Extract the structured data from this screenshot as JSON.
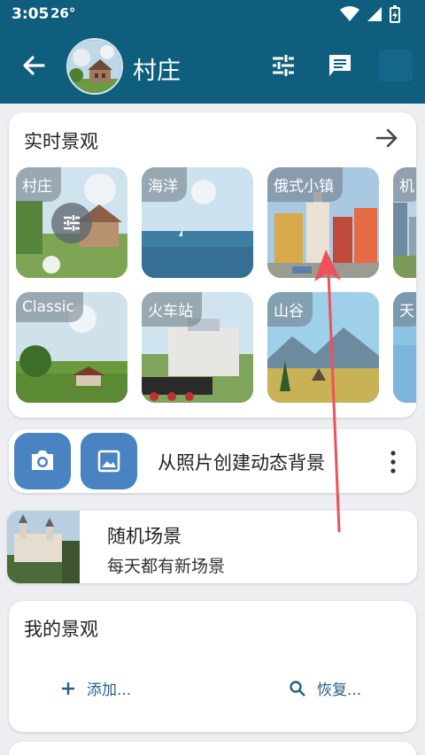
{
  "status": {
    "time": "3:05",
    "temperature": "26°"
  },
  "header": {
    "title": "村庄",
    "colors": {
      "bar": "#0f5e7d"
    }
  },
  "live": {
    "title": "实时景观",
    "tiles": [
      {
        "label": "村庄",
        "scene": "village"
      },
      {
        "label": "海洋",
        "scene": "ocean"
      },
      {
        "label": "俄式小镇",
        "scene": "russian-town"
      },
      {
        "label": "机",
        "scene": "city"
      },
      {
        "label": "Classic",
        "scene": "classic"
      },
      {
        "label": "火车站",
        "scene": "train-station"
      },
      {
        "label": "山谷",
        "scene": "valley"
      },
      {
        "label": "天",
        "scene": "sky"
      }
    ]
  },
  "photo": {
    "label": "从照片创建动态背景"
  },
  "random": {
    "title": "随机场景",
    "subtitle": "每天都有新场景"
  },
  "mine": {
    "title": "我的景观",
    "add_label": "添加...",
    "restore_label": "恢复..."
  },
  "colors": {
    "accent_button": "#4a83c1",
    "link": "#2a5f86",
    "annotation_arrow": "#f0505a"
  }
}
